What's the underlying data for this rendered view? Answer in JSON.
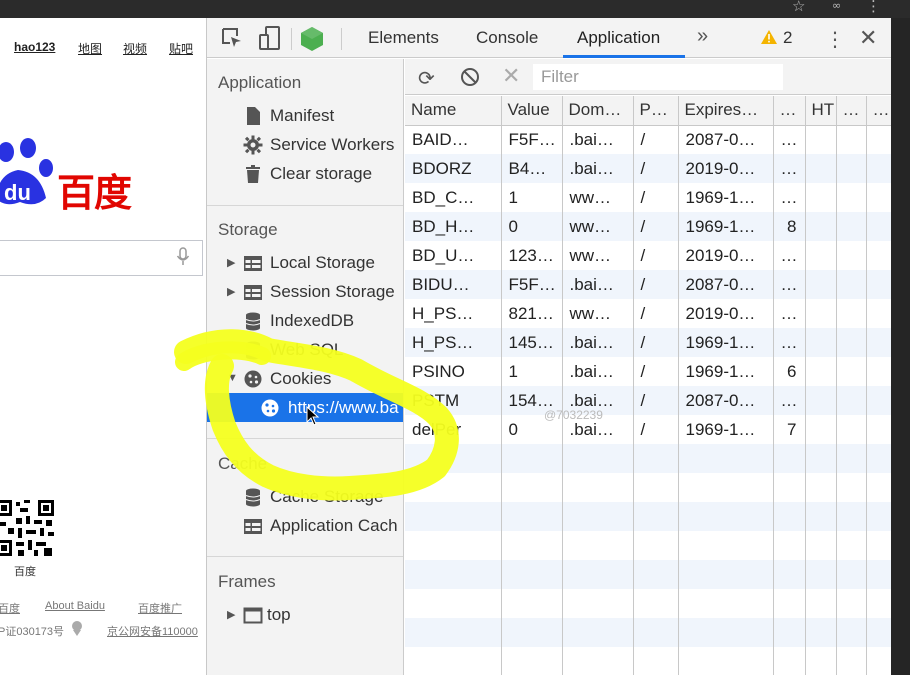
{
  "browser_page": {
    "nav_links": [
      "hao123",
      "地图",
      "视频",
      "贴吧"
    ],
    "logo_text": "百度",
    "logo_du": "du",
    "qr_label": "百度",
    "footer": {
      "baidu": "百度",
      "about": "About Baidu",
      "promo": "百度推广",
      "icp": "P证030173号",
      "police": "京公网安备110000"
    }
  },
  "devtools": {
    "tabs": [
      "Elements",
      "Console",
      "Application"
    ],
    "active_tab": "Application",
    "more_tabs_glyph": "»",
    "warning_count": "2",
    "sidebar": {
      "application_title": "Application",
      "application_items": [
        "Manifest",
        "Service Workers",
        "Clear storage"
      ],
      "storage_title": "Storage",
      "storage_items": [
        "Local Storage",
        "Session Storage",
        "IndexedDB",
        "Web SQL",
        "Cookies"
      ],
      "cookie_url": "https://www.ba",
      "cache_title": "Cache",
      "cache_items": [
        "Cache Storage",
        "Application Cach"
      ],
      "frames_title": "Frames",
      "frames_items": [
        "top"
      ]
    },
    "filter_placeholder": "Filter",
    "table": {
      "columns": [
        "Name",
        "Value",
        "Dom…",
        "P…",
        "Expires…",
        "…",
        "HT",
        "…",
        "…"
      ],
      "rows": [
        [
          "BAID…",
          "F5F…",
          ".bai…",
          "/",
          "2087-0…",
          "…",
          "",
          "",
          ""
        ],
        [
          "BDORZ",
          "B4…",
          ".bai…",
          "/",
          "2019-0…",
          "…",
          "",
          "",
          ""
        ],
        [
          "BD_C…",
          "1",
          "ww…",
          "/",
          "1969-1…",
          "…",
          "",
          "",
          ""
        ],
        [
          "BD_H…",
          "0",
          "ww…",
          "/",
          "1969-1…",
          "8",
          "",
          "",
          ""
        ],
        [
          "BD_U…",
          "123…",
          "ww…",
          "/",
          "2019-0…",
          "…",
          "",
          "",
          ""
        ],
        [
          "BIDU…",
          "F5F…",
          ".bai…",
          "/",
          "2087-0…",
          "…",
          "",
          "",
          ""
        ],
        [
          "H_PS…",
          "821…",
          "ww…",
          "/",
          "2019-0…",
          "…",
          "",
          "",
          ""
        ],
        [
          "H_PS…",
          "145…",
          ".bai…",
          "/",
          "1969-1…",
          "…",
          "",
          "",
          ""
        ],
        [
          "PSINO",
          "1",
          ".bai…",
          "/",
          "1969-1…",
          "6",
          "",
          "",
          ""
        ],
        [
          "PSTM",
          "154…",
          ".bai…",
          "/",
          "2087-0…",
          "…",
          "",
          "",
          ""
        ],
        [
          "delPer",
          "0",
          ".bai…",
          "/",
          "1969-1…",
          "7",
          "",
          "",
          ""
        ]
      ]
    },
    "watermark": "@7032239"
  },
  "colors": {
    "accent": "#1a73e8",
    "highlight": "#f4ff1f",
    "baidu_red": "#e10601",
    "baidu_blue": "#2932e1"
  }
}
